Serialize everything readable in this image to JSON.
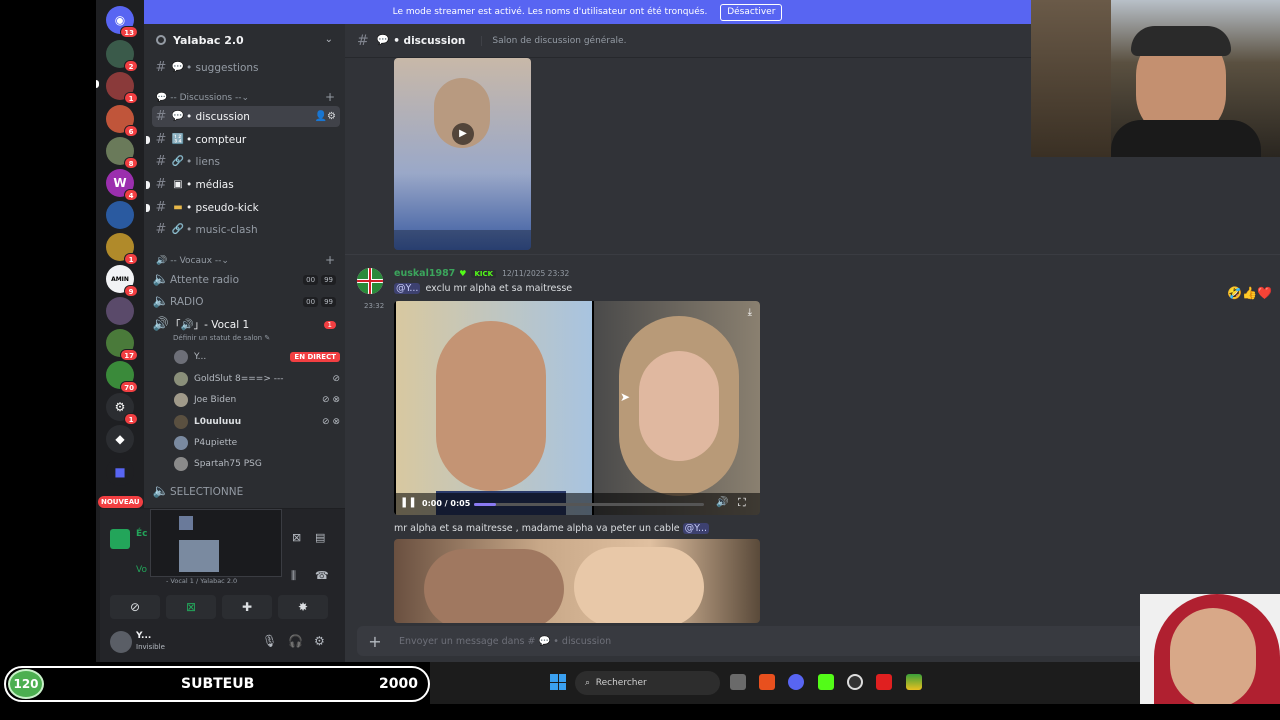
{
  "banner": {
    "text": "Le mode streamer est activé. Les noms d'utilisateur ont été tronqués.",
    "button": "Désactiver"
  },
  "server": {
    "name": "Yalabac 2.0"
  },
  "rail": {
    "badges": [
      "13",
      "2",
      "1",
      "6",
      "8",
      "4",
      "1",
      "9",
      "17",
      "70",
      "1"
    ],
    "new_label": "NOUVEAU"
  },
  "channels": {
    "top": {
      "name": "• suggestions"
    },
    "cat_discussions": "-- Discussions --",
    "items": [
      {
        "name": "• discussion"
      },
      {
        "name": "• compteur"
      },
      {
        "name": "• liens"
      },
      {
        "name": "• médias"
      },
      {
        "name": "• pseudo-kick"
      },
      {
        "name": "• music-clash"
      }
    ],
    "cat_vocaux": "-- Vocaux --",
    "voice": [
      {
        "name": "Attente radio",
        "count_a": "00",
        "count_b": "99"
      },
      {
        "name": "RADIO",
        "count_a": "00",
        "count_b": "99"
      },
      {
        "name": "「🔊」- Vocal 1",
        "badge": "1",
        "status": "Définir un statut de salon"
      }
    ],
    "voice_users": [
      {
        "name": "Y...",
        "live": "EN DIRECT"
      },
      {
        "name": "GoldSlut 8===> ---"
      },
      {
        "name": "Joe Biden"
      },
      {
        "name": "L0uuluuu"
      },
      {
        "name": "P4upiette"
      },
      {
        "name": "Spartah75 PSG"
      }
    ],
    "selected": "SELECTIONNÉ"
  },
  "voice_panel": {
    "line1": "Éc",
    "line2": "Vo",
    "sub": "- Vocal 1 / Yalabac 2.0"
  },
  "user": {
    "name": "Y...",
    "status": "Invisible"
  },
  "chat": {
    "channel": "• discussion",
    "topic": "Salon de discussion générale.",
    "author": "euskal1987",
    "kick": "KICK",
    "timestamp": "12/11/2025 23:32",
    "side_time": "23:32",
    "mention": "@Y...",
    "message1": "exclu mr alpha et sa maitresse",
    "video_time": "0:00 / 0:05",
    "message2": "mr alpha et sa maitresse , madame alpha va peter un cable",
    "composer_placeholder": "Envoyer un message dans # 💬 • discussion",
    "reactions": "🤣👍❤️"
  },
  "taskbar": {
    "search": "Rechercher"
  },
  "subgoal": {
    "count": "120",
    "label": "SUBTEUB",
    "goal": "2000"
  },
  "colors": {
    "blurple": "#5865f2",
    "kick_green": "#53fc18",
    "author_green": "#3ba55c",
    "danger": "#f23f42"
  }
}
